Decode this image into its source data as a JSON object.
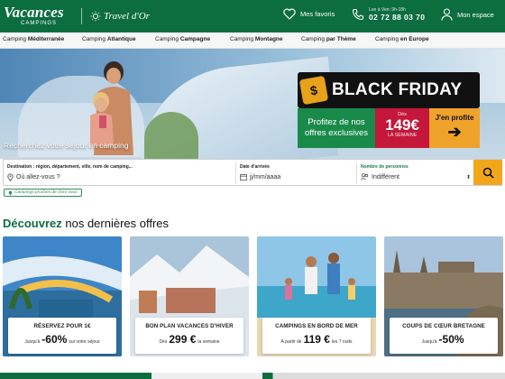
{
  "header": {
    "logo_main": "Vacances",
    "logo_sub": "CAMPINGS",
    "partner_logo": "Travel d'Or",
    "favorites_label": "Mes favoris",
    "phone_hours": "Lun à Ven: 9h-18h",
    "phone_number": "02 72 88 03 70",
    "account_label": "Mon espace",
    "brand_color": "#0c6d3f"
  },
  "nav": [
    {
      "prefix": "Camping",
      "bold": "Méditerranée"
    },
    {
      "prefix": "Camping",
      "bold": "Atlantique"
    },
    {
      "prefix": "Camping",
      "bold": "Campagne"
    },
    {
      "prefix": "Camping",
      "bold": "Montagne"
    },
    {
      "prefix": "Camping",
      "bold": "par Thème"
    },
    {
      "prefix": "Camping",
      "bold": "en Europe"
    }
  ],
  "hero": {
    "search_caption": "Recherchez votre séjour en camping",
    "promo": {
      "headline": "BLACK FRIDAY",
      "offer_text": "Profitez de nos offres exclusives",
      "price_prefix": "Dès",
      "price": "149€",
      "price_suffix": "LA SEMAINE",
      "cta": "J'en profite",
      "cta_arrow": "arrow-right-icon"
    }
  },
  "search": {
    "destination_label": "Destination : région, département, ville, nom de camping...",
    "destination_placeholder": "Où allez-vous ?",
    "date_label": "Date d'arrivée",
    "date_placeholder": "jj/mm/aaaa",
    "people_label": "Nombre de personnes",
    "people_value": "Indifférent",
    "nearby_chip": "Campings proches de chez vous"
  },
  "offers_section": {
    "title_bold": "Découvrez",
    "title_rest": "nos dernières offres"
  },
  "cards": [
    {
      "title": "RÉSERVEZ POUR 1€",
      "pre": "Jusqu'à",
      "big": "-60%",
      "post": "sur votre séjour"
    },
    {
      "title": "BON PLAN VACANCES D'HIVER",
      "pre": "Dès",
      "big": "299 €",
      "post": "la semaine"
    },
    {
      "title": "CAMPINGS EN BORD DE MER",
      "pre": "À partir de",
      "big": "119 €",
      "post": "les 7 nuits"
    },
    {
      "title": "COUPS DE CŒUR BRETAGNE",
      "pre": "Jusqu'à",
      "big": "-50%",
      "post": ""
    }
  ]
}
